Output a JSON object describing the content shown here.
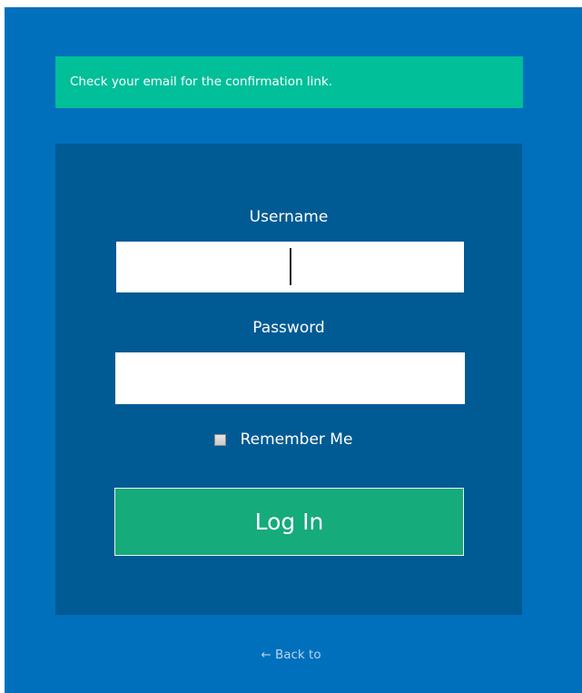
{
  "notice": {
    "message": "Check your email for the confirmation link."
  },
  "login_form": {
    "username_label": "Username",
    "username_value": "",
    "password_label": "Password",
    "password_value": "",
    "remember_label": "Remember Me",
    "remember_checked": false,
    "submit_label": "Log In"
  },
  "footer": {
    "back_link": "← Back to"
  },
  "colors": {
    "page_background": "#0070bd",
    "notice_background": "#00bf99",
    "panel_background": "#005a94",
    "button_background": "#15ab7b"
  }
}
